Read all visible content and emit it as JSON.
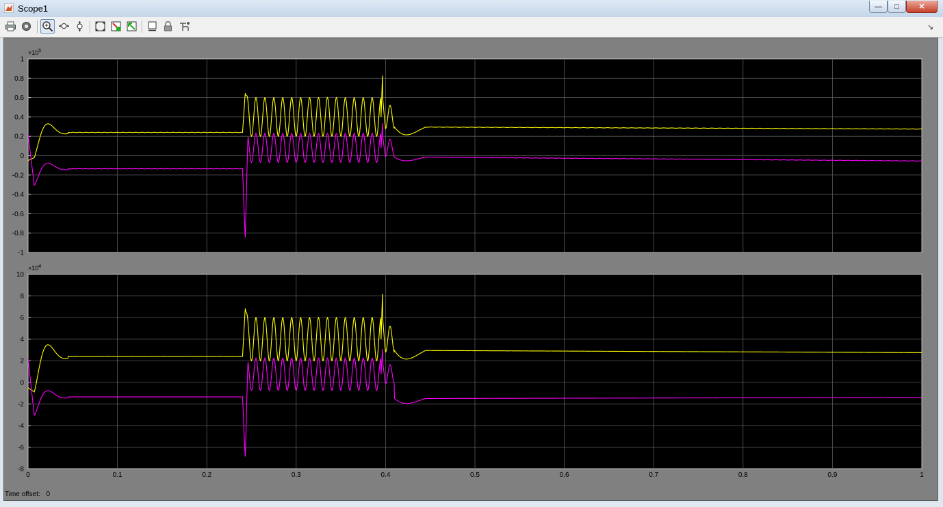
{
  "window": {
    "title": "Scope1",
    "controls": {
      "minimize": "—",
      "maximize": "□",
      "close": "✕"
    }
  },
  "toolbar": {
    "items": [
      {
        "id": "print",
        "icon": "printer-icon"
      },
      {
        "id": "params",
        "icon": "gear-icon"
      },
      {
        "id": "zoom",
        "icon": "zoom-in-icon",
        "active": true
      },
      {
        "id": "zoom-x",
        "icon": "zoom-x-icon"
      },
      {
        "id": "zoom-y",
        "icon": "zoom-y-icon"
      },
      {
        "id": "autoscale",
        "icon": "autoscale-icon"
      },
      {
        "id": "save-axes",
        "icon": "save-axes-icon"
      },
      {
        "id": "restore-axes",
        "icon": "restore-axes-icon"
      },
      {
        "id": "floating",
        "icon": "floating-scope-icon"
      },
      {
        "id": "lock",
        "icon": "lock-icon"
      },
      {
        "id": "signal-selection",
        "icon": "signal-selection-icon"
      }
    ],
    "dock_glyph": "↘"
  },
  "time_offset": {
    "label": "Time offset:",
    "value": "0"
  },
  "colors": {
    "series1": "#ffff00",
    "series2": "#ff00ff",
    "plot_bg": "#000000",
    "grid": "#5a5a5a"
  },
  "chart_data": [
    {
      "type": "line",
      "exponent_label": "×10",
      "exponent": "5",
      "xlim": [
        0,
        1
      ],
      "ylim": [
        -1,
        1
      ],
      "xticks": [],
      "yticks": [
        "1",
        "0.8",
        "0.6",
        "0.4",
        "0.2",
        "0",
        "-0.2",
        "-0.4",
        "-0.6",
        "-0.8",
        "-1"
      ],
      "grid": true,
      "series": [
        {
          "color": "#ffff00",
          "base": 0.24,
          "post": 0.295,
          "postEnd": 0.275,
          "osc_center": 0.4,
          "osc_amp": 0.2,
          "spike": 0.65,
          "spike2": 0.9,
          "preStart": -0.05,
          "preMin": -0.02,
          "prePeak": 0.32,
          "postDip": 0.16
        },
        {
          "color": "#ff00ff",
          "base": -0.135,
          "post": -0.015,
          "postEnd": -0.055,
          "osc_center": 0.08,
          "osc_amp": 0.15,
          "spike": -0.87,
          "spike2": 0.38,
          "preStart": 0.22,
          "preMin": -0.31,
          "prePeak": -0.09,
          "postDip": -0.08
        }
      ]
    },
    {
      "type": "line",
      "exponent_label": "×10",
      "exponent": "4",
      "xlim": [
        0,
        1
      ],
      "ylim": [
        -8,
        10
      ],
      "xticks": [
        "0",
        "0.1",
        "0.2",
        "0.3",
        "0.4",
        "0.5",
        "0.6",
        "0.7",
        "0.8",
        "0.9",
        "1"
      ],
      "yticks": [
        "10",
        "8",
        "6",
        "4",
        "2",
        "0",
        "-2",
        "-4",
        "-6",
        "-8"
      ],
      "grid": true,
      "series": [
        {
          "color": "#ffff00",
          "base": 2.4,
          "post": 2.95,
          "postEnd": 2.75,
          "osc_center": 4.0,
          "osc_amp": 2.0,
          "spike": 6.9,
          "spike2": 8.9,
          "preStart": -0.5,
          "preMin": -0.9,
          "prePeak": 3.2,
          "postDip": 1.6
        },
        {
          "color": "#ff00ff",
          "base": -1.35,
          "post": -1.5,
          "postEnd": -1.4,
          "osc_center": 0.75,
          "osc_amp": 1.5,
          "spike": -7.1,
          "spike2": 3.5,
          "preStart": 2.2,
          "preMin": -3.1,
          "prePeak": -0.9,
          "postDip": -2.3
        }
      ]
    }
  ]
}
